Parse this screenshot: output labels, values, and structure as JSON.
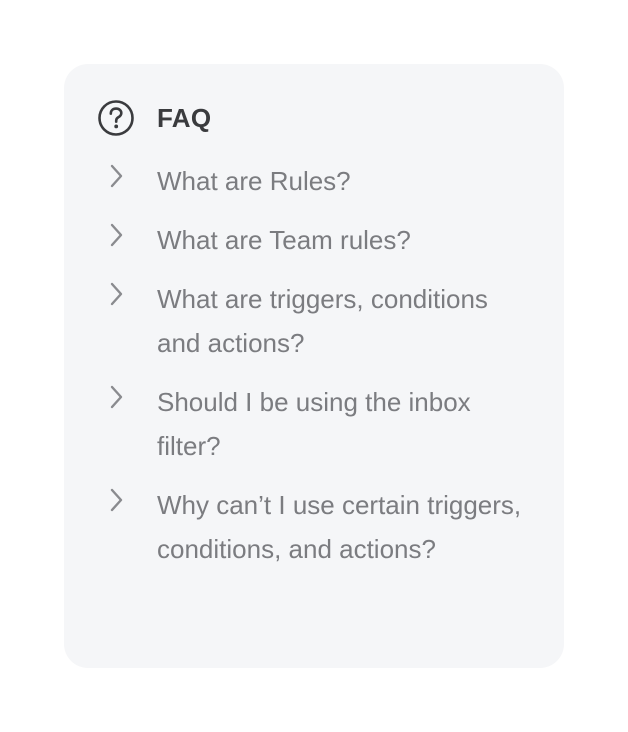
{
  "faq": {
    "title": "FAQ",
    "header_icon": "question-circle-icon",
    "item_icon": "chevron-right-icon",
    "items": [
      {
        "question": "What are Rules?"
      },
      {
        "question": "What are Team rules?"
      },
      {
        "question": "What are triggers, conditions and actions?"
      },
      {
        "question": "Should I be using the inbox filter?"
      },
      {
        "question": "Why can’t I use certain triggers, conditions, and actions?"
      }
    ],
    "colors": {
      "card_background": "#f5f6f8",
      "title_text": "#3a3b3e",
      "question_text": "#7b7c80",
      "icon": "#3a3b3e",
      "chevron": "#8a8b8f"
    }
  }
}
